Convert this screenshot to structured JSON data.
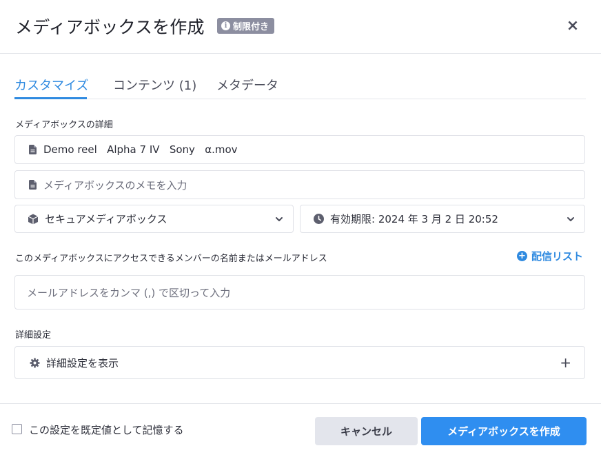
{
  "header": {
    "title": "メディアボックスを作成",
    "badge": "制限付き",
    "badge_icon": "i",
    "close": "×"
  },
  "tabs": [
    {
      "label": "カスタマイズ",
      "active": true
    },
    {
      "label": "コンテンツ (1)",
      "active": false
    },
    {
      "label": "メタデータ",
      "active": false
    }
  ],
  "details": {
    "section_label": "メディアボックスの詳細",
    "name_value": "Demo reel   Alpha 7 IV   Sony   α.mov",
    "memo_placeholder": "メディアボックスのメモを入力",
    "type_select": "セキュアメディアボックス",
    "expiry_select": "有効期限: 2024 年 3 月 2 日 20:52"
  },
  "access": {
    "section_label": "このメディアボックスにアクセスできるメンバーの名前またはメールアドレス",
    "distribution_link": "配信リスト",
    "email_placeholder": "メールアドレスをカンマ (,) で区切って入力"
  },
  "advanced": {
    "section_label": "詳細設定",
    "toggle_label": "詳細設定を表示",
    "toggle_icon": "+"
  },
  "footer": {
    "remember_label": "この設定を既定値として記憶する",
    "remember_checked": false,
    "cancel_label": "キャンセル",
    "create_label": "メディアボックスを作成"
  },
  "colors": {
    "accent": "#2f8ae0",
    "primary_button": "#2f8ef0",
    "badge": "#8c8ea0"
  }
}
